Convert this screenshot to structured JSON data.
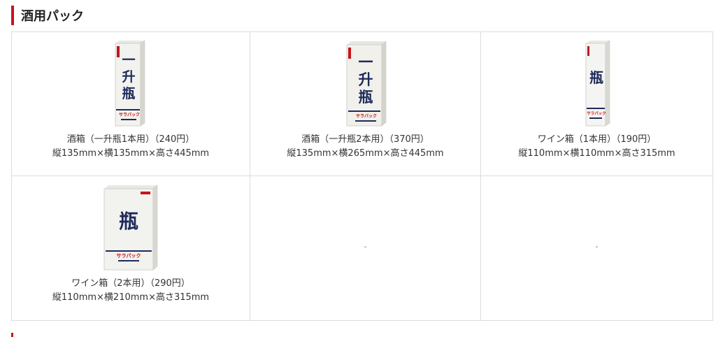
{
  "section": {
    "title": "酒用パック"
  },
  "items": [
    {
      "image": "sake-box-1-bottle",
      "box_text": "一升瓶",
      "brand": "サラパック",
      "name": "酒箱（一升瓶1本用）（240円）",
      "size": "縦135mm×横135mm×高さ445mm"
    },
    {
      "image": "sake-box-2-bottles",
      "box_text": "一升瓶",
      "brand": "サラパック",
      "name": "酒箱（一升瓶2本用）（370円）",
      "size": "縦135mm×横265mm×高さ445mm"
    },
    {
      "image": "wine-box-1-bottle",
      "box_text": "瓶",
      "brand": "サラパック",
      "name": "ワイン箱（1本用）（190円）",
      "size": "縦110mm×横110mm×高さ315mm"
    },
    {
      "image": "wine-box-2-bottles",
      "box_text": "瓶",
      "brand": "サラパック",
      "name": "ワイン箱（2本用）（290円）",
      "size": "縦110mm×横210mm×高さ315mm"
    }
  ],
  "empty_cells": [
    "-",
    "-"
  ],
  "colors": {
    "accent": "#c4161c",
    "border": "#dcdcdc",
    "box_ink": "#1e2a5a"
  }
}
